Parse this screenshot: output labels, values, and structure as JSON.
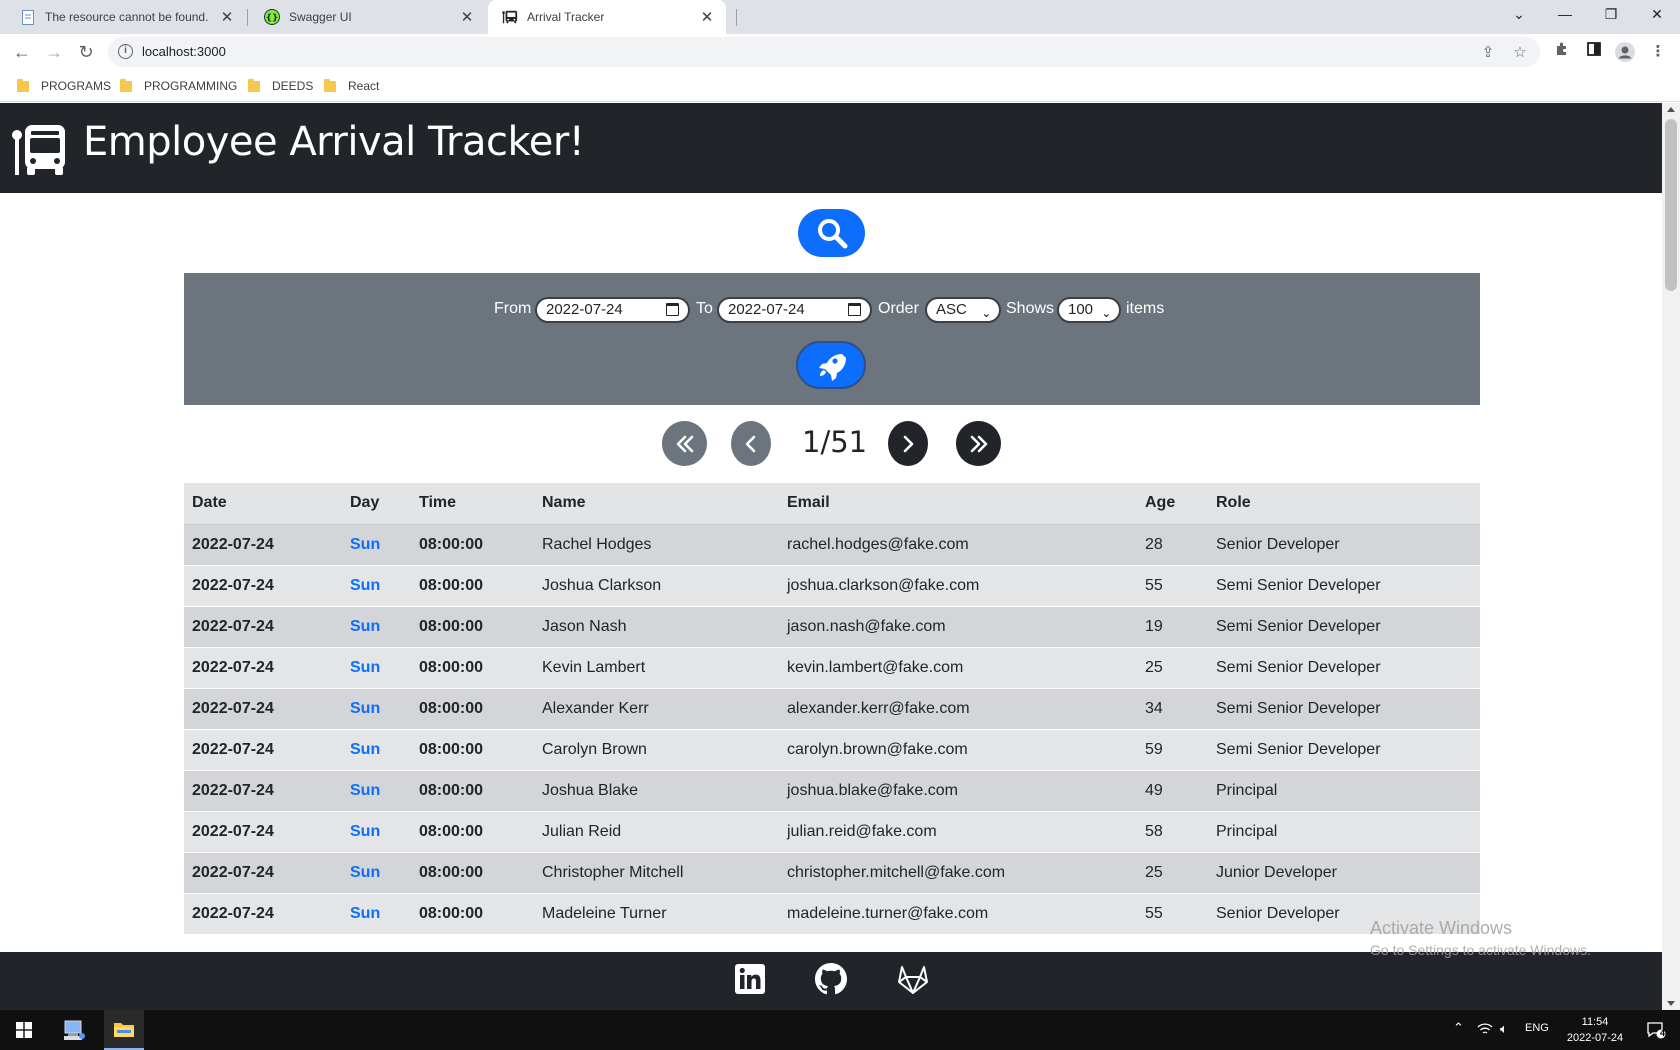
{
  "browser": {
    "tabs": [
      {
        "title": "The resource cannot be found.",
        "favicon": "document-icon",
        "active": false
      },
      {
        "title": "Swagger UI",
        "favicon": "swagger-icon",
        "active": false
      },
      {
        "title": "Arrival Tracker",
        "favicon": "bus-icon",
        "active": true
      }
    ],
    "url": "localhost:3000",
    "bookmarks": [
      "PROGRAMS",
      "PROGRAMMING",
      "DEEDS",
      "React"
    ]
  },
  "app": {
    "title": "Employee Arrival Tracker!",
    "colors": {
      "header": "#212529",
      "primary": "#0d6efd",
      "panel": "#6c757d"
    }
  },
  "filters": {
    "from_label": "From",
    "from_value": "2022-07-24",
    "to_label": "To",
    "to_value": "2022-07-24",
    "order_label": "Order",
    "order_value": "ASC",
    "shows_label": "Shows",
    "shows_value": "100",
    "items_label": "items"
  },
  "pagination": {
    "indicator": "1/51"
  },
  "table": {
    "headers": [
      "Date",
      "Day",
      "Time",
      "Name",
      "Email",
      "Age",
      "Role"
    ],
    "rows": [
      {
        "date": "2022-07-24",
        "day": "Sun",
        "time": "08:00:00",
        "name": "Rachel Hodges",
        "email": "rachel.hodges@fake.com",
        "age": "28",
        "role": "Senior Developer"
      },
      {
        "date": "2022-07-24",
        "day": "Sun",
        "time": "08:00:00",
        "name": "Joshua Clarkson",
        "email": "joshua.clarkson@fake.com",
        "age": "55",
        "role": "Semi Senior Developer"
      },
      {
        "date": "2022-07-24",
        "day": "Sun",
        "time": "08:00:00",
        "name": "Jason Nash",
        "email": "jason.nash@fake.com",
        "age": "19",
        "role": "Semi Senior Developer"
      },
      {
        "date": "2022-07-24",
        "day": "Sun",
        "time": "08:00:00",
        "name": "Kevin Lambert",
        "email": "kevin.lambert@fake.com",
        "age": "25",
        "role": "Semi Senior Developer"
      },
      {
        "date": "2022-07-24",
        "day": "Sun",
        "time": "08:00:00",
        "name": "Alexander Kerr",
        "email": "alexander.kerr@fake.com",
        "age": "34",
        "role": "Semi Senior Developer"
      },
      {
        "date": "2022-07-24",
        "day": "Sun",
        "time": "08:00:00",
        "name": "Carolyn Brown",
        "email": "carolyn.brown@fake.com",
        "age": "59",
        "role": "Semi Senior Developer"
      },
      {
        "date": "2022-07-24",
        "day": "Sun",
        "time": "08:00:00",
        "name": "Joshua Blake",
        "email": "joshua.blake@fake.com",
        "age": "49",
        "role": "Principal"
      },
      {
        "date": "2022-07-24",
        "day": "Sun",
        "time": "08:00:00",
        "name": "Julian Reid",
        "email": "julian.reid@fake.com",
        "age": "58",
        "role": "Principal"
      },
      {
        "date": "2022-07-24",
        "day": "Sun",
        "time": "08:00:00",
        "name": "Christopher Mitchell",
        "email": "christopher.mitchell@fake.com",
        "age": "25",
        "role": "Junior Developer"
      },
      {
        "date": "2022-07-24",
        "day": "Sun",
        "time": "08:00:00",
        "name": "Madeleine Turner",
        "email": "madeleine.turner@fake.com",
        "age": "55",
        "role": "Senior Developer"
      }
    ]
  },
  "footer": {
    "icons": [
      "linkedin-icon",
      "github-icon",
      "gitlab-icon"
    ]
  },
  "watermark": {
    "title": "Activate Windows",
    "subtitle": "Go to Settings to activate Windows."
  },
  "taskbar": {
    "language": "ENG",
    "time": "11:54",
    "date": "2022-07-24",
    "notifications": "4"
  }
}
